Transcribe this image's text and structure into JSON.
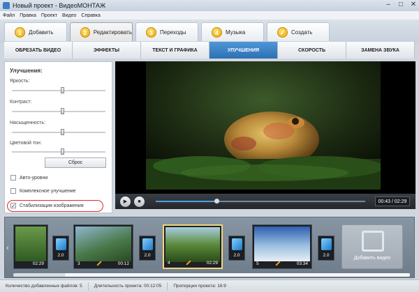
{
  "window": {
    "title": "Новый проект - ВидеоМОНТАЖ",
    "controls": [
      "–",
      "□",
      "✕"
    ]
  },
  "menu": [
    "Файл",
    "Правка",
    "Проект",
    "Видео",
    "Справка"
  ],
  "steps": [
    {
      "num": "1",
      "label": "Добавить"
    },
    {
      "num": "2",
      "label": "Редактировать"
    },
    {
      "num": "3",
      "label": "Переходы"
    },
    {
      "num": "4",
      "label": "Музыка"
    },
    {
      "num": "✓",
      "label": "Создать"
    }
  ],
  "tabs": [
    "ОБРЕЗАТЬ ВИДЕО",
    "ЭФФЕКТЫ",
    "ТЕКСТ И ГРАФИКА",
    "УЛУЧШЕНИЯ",
    "СКОРОСТЬ",
    "ЗАМЕНА ЗВУКА"
  ],
  "active_tab": "УЛУЧШЕНИЯ",
  "panel": {
    "title": "Улучшения:",
    "sliders": [
      {
        "label": "Яркость:",
        "value": 0.55
      },
      {
        "label": "Контраст:",
        "value": 0.55
      },
      {
        "label": "Насыщенность:",
        "value": 0.55
      },
      {
        "label": "Цветовой тон:",
        "value": 0.55
      }
    ],
    "reset_label": "Сброс",
    "checkboxes": [
      {
        "label": "Авто-уровни",
        "checked": false
      },
      {
        "label": "Комплексное улучшение",
        "checked": false
      },
      {
        "label": "Стабилизация изображения",
        "checked": true
      }
    ]
  },
  "player": {
    "time": "00:43 / 02:29",
    "progress": 0.29,
    "play_icon": "▶",
    "stop_icon": "■"
  },
  "timeline": {
    "clips": [
      {
        "num": "",
        "duration": "02:29"
      },
      {
        "num": "3",
        "duration": "00:12"
      },
      {
        "num": "4",
        "duration": "02:29"
      },
      {
        "num": "5",
        "duration": "03:34"
      }
    ],
    "transitions": [
      "2.0",
      "2.0",
      "2.0",
      "2.0"
    ],
    "add_video_label": "Добавить видео",
    "scroll_left": "‹"
  },
  "status": {
    "files": "Количество добавленных файлов: 5",
    "duration": "Длительность проекта: 00:12:05",
    "aspect": "Пропорции проекта: 16:9"
  },
  "colors": {
    "accent": "#2d6fb4",
    "highlight": "#d92b2b"
  }
}
